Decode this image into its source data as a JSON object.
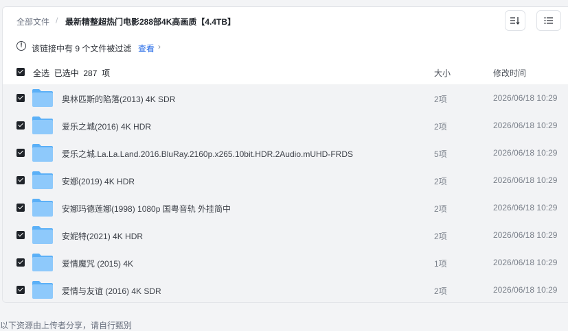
{
  "breadcrumb": {
    "root": "全部文件",
    "separator": "/",
    "current": "最新精整超热门电影288部4K高画质【4.4TB】"
  },
  "toolbar": {
    "sort_icon": "sort-icon",
    "list_view_icon": "list-view-icon"
  },
  "filter_notice": {
    "icon": "!",
    "text": "该链接中有 9 个文件被过滤",
    "link": "查看",
    "arrow": "›"
  },
  "list_header": {
    "select_all": "全选",
    "selected_prefix": "已选中",
    "selected_count": "287",
    "selected_suffix": "项",
    "size_col": "大小",
    "mtime_col": "修改时间"
  },
  "files": [
    {
      "name": "奥林匹斯的陷落(2013) 4K SDR",
      "size": "2项",
      "mtime": "2026/06/18 10:29",
      "checked": true
    },
    {
      "name": "爱乐之城(2016) 4K HDR",
      "size": "2项",
      "mtime": "2026/06/18 10:29",
      "checked": true
    },
    {
      "name": "爱乐之城.La.La.Land.2016.BluRay.2160p.x265.10bit.HDR.2Audio.mUHD-FRDS",
      "size": "5项",
      "mtime": "2026/06/18 10:29",
      "checked": true
    },
    {
      "name": "安娜(2019) 4K HDR",
      "size": "2项",
      "mtime": "2026/06/18 10:29",
      "checked": true
    },
    {
      "name": "安娜玛德莲娜(1998) 1080p 国粤音轨 外挂简中",
      "size": "2项",
      "mtime": "2026/06/18 10:29",
      "checked": true
    },
    {
      "name": "安妮特(2021) 4K HDR",
      "size": "2项",
      "mtime": "2026/06/18 10:29",
      "checked": true
    },
    {
      "name": "爱情魔咒 (2015) 4K",
      "size": "1项",
      "mtime": "2026/06/18 10:29",
      "checked": true
    },
    {
      "name": "爱情与友谊 (2016) 4K SDR",
      "size": "2项",
      "mtime": "2026/06/18 10:29",
      "checked": true
    }
  ],
  "footer": {
    "text": "以下资源由上传者分享，请自行甄别"
  },
  "colors": {
    "accent": "#2a6ee8",
    "folder_light": "#8ec9fb",
    "folder_dark": "#5bb0f7",
    "row_bg": "#f2f3f5"
  }
}
